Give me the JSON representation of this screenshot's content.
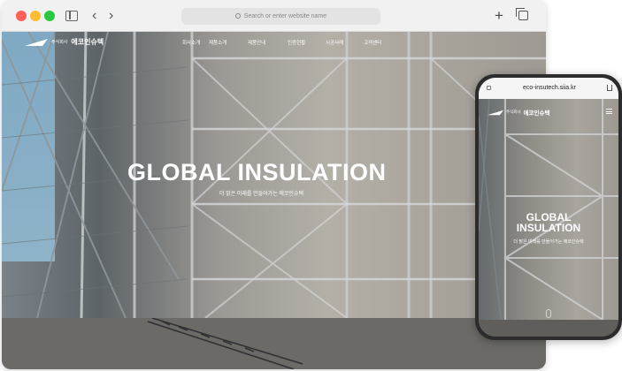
{
  "browser": {
    "url_placeholder": "Search or enter website name"
  },
  "site": {
    "logo_small": "주식회사",
    "logo_main": "에코인슈텍",
    "nav": [
      "회사소개",
      "제품소개",
      "제품안내",
      "인증현황",
      "시공사례",
      "고객센터"
    ],
    "hero_title": "GLOBAL INSULATION",
    "hero_subtitle": "더 밝은 미래를 만들어가는 에코인슈텍"
  },
  "phone": {
    "url": "eco-insutech.siia.kr",
    "hero_title_line1": "GLOBAL",
    "hero_title_line2": "INSULATION",
    "hero_subtitle": "더 밝은 미래를 만들어가는 에코인슈텍"
  }
}
